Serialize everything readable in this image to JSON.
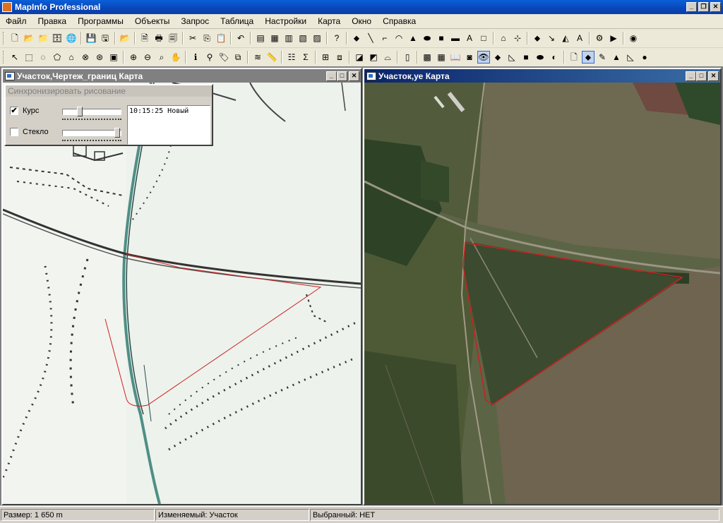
{
  "app": {
    "title": "MapInfo Professional"
  },
  "window_buttons": {
    "minimize": "_",
    "restore": "❐",
    "close": "✕"
  },
  "menu": [
    "Файл",
    "Правка",
    "Программы",
    "Объекты",
    "Запрос",
    "Таблица",
    "Настройки",
    "Карта",
    "Окно",
    "Справка"
  ],
  "toolbar1": [
    {
      "name": "new-icon",
      "glyph": "🗋"
    },
    {
      "name": "open-icon",
      "glyph": "📂"
    },
    {
      "name": "open-workspace-icon",
      "glyph": "📁"
    },
    {
      "name": "open-dbms-icon",
      "glyph": "🗄"
    },
    {
      "name": "open-web-icon",
      "glyph": "🌐"
    },
    {
      "sep": true
    },
    {
      "name": "save-icon",
      "glyph": "💾"
    },
    {
      "name": "save-workspace-icon",
      "glyph": "🖫"
    },
    {
      "sep": true
    },
    {
      "name": "open-universal-icon",
      "glyph": "📂"
    },
    {
      "sep": true
    },
    {
      "name": "print-preview-icon",
      "glyph": "🗎"
    },
    {
      "name": "print-icon",
      "glyph": "🖶"
    },
    {
      "name": "export-pdf-icon",
      "glyph": "🗐"
    },
    {
      "sep": true
    },
    {
      "name": "cut-icon",
      "glyph": "✂"
    },
    {
      "name": "copy-icon",
      "glyph": "⎘"
    },
    {
      "name": "paste-icon",
      "glyph": "📋"
    },
    {
      "sep": true
    },
    {
      "name": "undo-icon",
      "glyph": "↶"
    },
    {
      "sep": true
    },
    {
      "name": "new-browser-icon",
      "glyph": "▤"
    },
    {
      "name": "new-mapper-icon",
      "glyph": "▦"
    },
    {
      "name": "new-grapher-icon",
      "glyph": "▥"
    },
    {
      "name": "new-layout-icon",
      "glyph": "▧"
    },
    {
      "name": "new-redistrict-icon",
      "glyph": "▨"
    },
    {
      "sep": true
    },
    {
      "name": "help-icon",
      "glyph": "?"
    },
    {
      "sep": true
    },
    {
      "name": "symbol-icon",
      "glyph": "⬥"
    },
    {
      "name": "line-icon",
      "glyph": "╲"
    },
    {
      "name": "polyline-icon",
      "glyph": "⌐"
    },
    {
      "name": "arc-icon",
      "glyph": "◠"
    },
    {
      "name": "polygon-icon",
      "glyph": "▲"
    },
    {
      "name": "ellipse-icon",
      "glyph": "⬬"
    },
    {
      "name": "rectangle-icon",
      "glyph": "■"
    },
    {
      "name": "rounded-rect-icon",
      "glyph": "▬"
    },
    {
      "name": "text-icon",
      "glyph": "A"
    },
    {
      "name": "frame-icon",
      "glyph": "□"
    },
    {
      "sep": true
    },
    {
      "name": "reshape-icon",
      "glyph": "⌂"
    },
    {
      "name": "add-node-icon",
      "glyph": "⊹"
    },
    {
      "sep": true
    },
    {
      "name": "symbol-style-icon",
      "glyph": "⬥"
    },
    {
      "name": "line-style-icon",
      "glyph": "↘"
    },
    {
      "name": "region-style-icon",
      "glyph": "◭"
    },
    {
      "name": "text-style-icon",
      "glyph": "A"
    },
    {
      "sep": true
    },
    {
      "name": "tool-manager-icon",
      "glyph": "⚙"
    },
    {
      "name": "run-program-icon",
      "glyph": "▶"
    },
    {
      "sep": true
    },
    {
      "name": "mapbasic-icon",
      "glyph": "◉"
    }
  ],
  "toolbar2": [
    {
      "name": "select-arrow-icon",
      "glyph": "↖"
    },
    {
      "name": "marquee-select-icon",
      "glyph": "⬚"
    },
    {
      "name": "radius-select-icon",
      "glyph": "◌"
    },
    {
      "name": "polygon-select-icon",
      "glyph": "⬠"
    },
    {
      "name": "boundary-select-icon",
      "glyph": "⌂"
    },
    {
      "name": "unselect-all-icon",
      "glyph": "⊗"
    },
    {
      "name": "invert-selection-icon",
      "glyph": "⊛"
    },
    {
      "name": "graph-select-icon",
      "glyph": "▣"
    },
    {
      "sep": true
    },
    {
      "name": "zoom-in-icon",
      "glyph": "⊕"
    },
    {
      "name": "zoom-out-icon",
      "glyph": "⊖"
    },
    {
      "name": "change-view-icon",
      "glyph": "⌕"
    },
    {
      "name": "pan-icon",
      "glyph": "✋"
    },
    {
      "sep": true
    },
    {
      "name": "info-icon",
      "glyph": "ℹ"
    },
    {
      "name": "hotlink-icon",
      "glyph": "⚲"
    },
    {
      "name": "label-icon",
      "glyph": "🏷"
    },
    {
      "name": "drag-window-icon",
      "glyph": "⧉"
    },
    {
      "sep": true
    },
    {
      "name": "layer-control-icon",
      "glyph": "≋"
    },
    {
      "name": "ruler-icon",
      "glyph": "📏"
    },
    {
      "sep": true
    },
    {
      "name": "show-legend-icon",
      "glyph": "☷"
    },
    {
      "name": "show-statistics-icon",
      "glyph": "Σ"
    },
    {
      "sep": true
    },
    {
      "name": "set-target-icon",
      "glyph": "⊞"
    },
    {
      "name": "clip-region-icon",
      "glyph": "⧈"
    },
    {
      "sep": true
    },
    {
      "name": "map-icon-a",
      "glyph": "◪"
    },
    {
      "name": "map-icon-b",
      "glyph": "◩"
    },
    {
      "name": "map-icon-c",
      "glyph": "⌓"
    },
    {
      "sep": true
    },
    {
      "name": "scale-bar-icon",
      "glyph": "▯"
    },
    {
      "sep": true
    },
    {
      "name": "digitize-icon",
      "glyph": "▩"
    },
    {
      "name": "table-icon",
      "glyph": "▦"
    },
    {
      "name": "book-icon",
      "glyph": "📖"
    },
    {
      "name": "record-icon",
      "glyph": "◙"
    },
    {
      "name": "eye-icon",
      "glyph": "👁",
      "pressed": true
    },
    {
      "name": "point-icon",
      "glyph": "⬥"
    },
    {
      "name": "polyline-draw-icon",
      "glyph": "◺"
    },
    {
      "name": "rect-draw-icon",
      "glyph": "■"
    },
    {
      "name": "ellipse-draw-icon",
      "glyph": "⬬"
    },
    {
      "name": "query-icon",
      "glyph": "◐"
    },
    {
      "sep": true
    },
    {
      "name": "page-icon",
      "glyph": "🗋"
    },
    {
      "name": "sync-point-icon",
      "glyph": "⬥",
      "pressed": true
    },
    {
      "name": "pencil-icon",
      "glyph": "✎"
    },
    {
      "name": "region-draw-icon",
      "glyph": "▲"
    },
    {
      "name": "line-draw-icon",
      "glyph": "◺"
    },
    {
      "name": "stop-icon",
      "glyph": "●"
    }
  ],
  "windows": {
    "left": {
      "title": "Участок,Чертеж_границ Карта"
    },
    "right": {
      "title": "Участок,уе Карта"
    }
  },
  "sync_panel": {
    "title": "Синхронизировать рисование",
    "course_label": "Курс",
    "course_checked": "✔",
    "glass_label": "Стекло",
    "glass_checked": "",
    "course_slider_level": 0.28,
    "glass_slider_level": 0.98,
    "log_text": "10:15:25 Новый"
  },
  "status": {
    "size": "Размер: 1 650 m",
    "editable": "Изменяемый: Участок",
    "selected": "Выбранный: НЕТ"
  },
  "colors": {
    "boundary": "#cc2020",
    "title_active": "#0a246a",
    "title_inactive": "#808080"
  }
}
